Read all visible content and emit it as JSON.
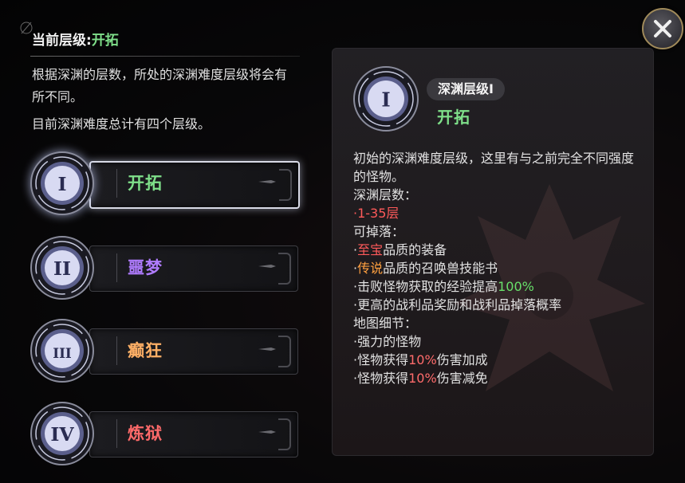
{
  "current": {
    "label": "当前层级:",
    "value": "开拓"
  },
  "description": {
    "line1": "根据深渊的层数，所处的深渊难度层级将会有所不同。",
    "line2": "目前深渊难度总计有四个层级。"
  },
  "tiers": [
    {
      "numeral": "I",
      "name": "开拓",
      "color": "#7fe08a",
      "selected": true
    },
    {
      "numeral": "II",
      "name": "噩梦",
      "color": "#b07cff",
      "selected": false
    },
    {
      "numeral": "III",
      "name": "癫狂",
      "color": "#ffb066",
      "selected": false
    },
    {
      "numeral": "IV",
      "name": "炼狱",
      "color": "#ff6a6a",
      "selected": false
    }
  ],
  "detail": {
    "numeral": "I",
    "badge": "深渊层级I",
    "name": "开拓",
    "intro": "初始的深渊难度层级，这里有与之前完全不同强度的怪物。",
    "floors_label": "深渊层数：",
    "floors_value": "·1-35层",
    "drops_label": "可掉落：",
    "drop1_prefix": "·",
    "drop1_highlight": "至宝",
    "drop1_suffix": "品质的装备",
    "drop2_prefix": "·",
    "drop2_highlight": "传说",
    "drop2_suffix": "品质的召唤兽技能书",
    "drop3_prefix": "·击败怪物获取的经验提高",
    "drop3_highlight": "100%",
    "drop4": "·更高的战利品奖励和战利品掉落概率",
    "map_label": "地图细节：",
    "map1": "·强力的怪物",
    "map2_prefix": "·怪物获得",
    "map2_highlight": "10%",
    "map2_suffix": "伤害加成",
    "map3_prefix": "·怪物获得",
    "map3_highlight": "10%",
    "map3_suffix": "伤害减免"
  },
  "icons": {
    "close": "close-icon",
    "arrow": "arrow-icon",
    "medal": "tier-medal-icon"
  },
  "colors": {
    "accent_green": "#7fe08a",
    "highlight_red": "#ff5a5a",
    "highlight_orange": "#ffa040"
  }
}
